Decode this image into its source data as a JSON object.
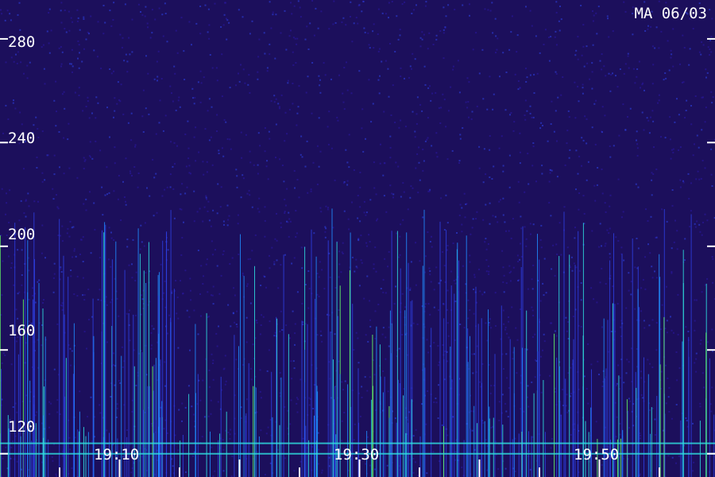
{
  "chart_data": {
    "type": "heatmap",
    "title": "MA 06/03",
    "xlabel": "",
    "ylabel": "",
    "y_ticks": [
      120,
      160,
      200,
      240,
      280
    ],
    "x_tick_labels": [
      "19:10",
      "19:30",
      "19:50"
    ],
    "ylim": [
      111,
      295
    ],
    "grid": false,
    "colormap": [
      "#1c0f5c",
      "#2a18a0",
      "#2d3fe0",
      "#1f8cff",
      "#2fe0e0",
      "#66ff66"
    ],
    "features": [
      {
        "name": "baseline-band",
        "value": 120
      },
      {
        "name": "baseline-band",
        "value": 124
      }
    ]
  }
}
